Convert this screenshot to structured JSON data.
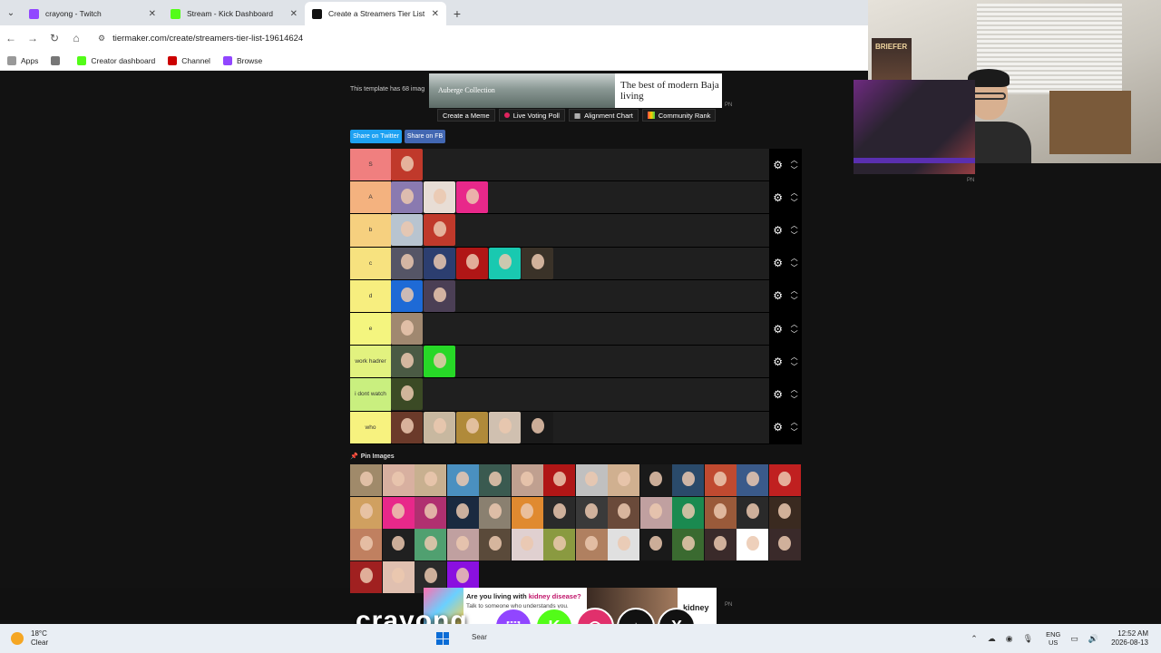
{
  "browser": {
    "tabs": [
      {
        "title": "crayong - Twitch",
        "color": "#9146ff",
        "active": false
      },
      {
        "title": "Stream - Kick Dashboard",
        "color": "#53fc18",
        "active": false
      },
      {
        "title": "Create a Streamers Tier List - Tie",
        "color": "#111111",
        "active": true
      }
    ],
    "new_tab": "+",
    "url": "tiermaker.com/create/streamers-tier-list-19614624",
    "bookmarks": [
      {
        "label": "Apps"
      },
      {
        "label": "Creator dashboard"
      },
      {
        "label": "Channel"
      },
      {
        "label": "Browse"
      }
    ]
  },
  "page": {
    "template_note": "This template has 68 imag",
    "ad_top": {
      "brand": "Auberge Collection",
      "copy": "The best of modern Baja living"
    },
    "menu": [
      "Create a Meme",
      "Live Voting Poll",
      "Alignment Chart",
      "Community Rank"
    ],
    "share": {
      "twitter": "Share on Twitter",
      "fb": "Share on FB"
    },
    "pin_label": "Pin Images",
    "pn_text": "PN"
  },
  "tiers": [
    {
      "label": "S",
      "color": "#f07f7f",
      "items": [
        "#c0392b"
      ]
    },
    {
      "label": "A",
      "color": "#f4b27f",
      "items": [
        "#8a7ab0",
        "#e8ddd5",
        "#e8288a"
      ]
    },
    {
      "label": "b",
      "color": "#f6d07f",
      "items": [
        "#b8c4d0",
        "#c0392b"
      ]
    },
    {
      "label": "c",
      "color": "#f7e27f",
      "items": [
        "#556",
        "#2c3e70",
        "#b01616",
        "#19c9b0",
        "#3a3228"
      ]
    },
    {
      "label": "d",
      "color": "#f7ee7f",
      "items": [
        "#1e6ad6",
        "#4b3f55"
      ]
    },
    {
      "label": "e",
      "color": "#f4f57f",
      "items": [
        "#a08870"
      ]
    },
    {
      "label": "work hadrer",
      "color": "#e2f27f",
      "items": [
        "#4a5a44",
        "#27d827"
      ]
    },
    {
      "label": "i dont watch",
      "color": "#c9ef7f",
      "items": [
        "#3b4a25"
      ]
    },
    {
      "label": "who",
      "color": "#f7f27f",
      "items": [
        "#6b3a2a",
        "#c8b8a0",
        "#b08a3a",
        "#d0c0b0",
        "#1a1a1a"
      ]
    }
  ],
  "pool": [
    "#a08a6a",
    "#d8b0a0",
    "#c8b090",
    "#4a90c0",
    "#3a5a50",
    "#c0a090",
    "#b01616",
    "#c0c0c0",
    "#d0b090",
    "#1a1a1a",
    "#2a4a6a",
    "#c04a30",
    "#3a5a8a",
    "#c02020",
    "#d0a060",
    "#e8288a",
    "#b03070",
    "#1a2a40",
    "#8a8070",
    "#e08a30",
    "#2a2a2a",
    "#3a3a3a",
    "#6a4a3a",
    "#c0a0a0",
    "#1a8a50",
    "#9a5a3a",
    "#2a2a2a",
    "#3a2a20",
    "#c08060",
    "#202020",
    "#50a070",
    "#c0a0a0",
    "#5a4a3a",
    "#e0d0d0",
    "#8a9a40",
    "#b08060",
    "#e0e0e0",
    "#1a1a1a",
    "#3a6a30",
    "#3a2a2a",
    "#ffffff",
    "#3a2a2a",
    "#a02020",
    "#e0c0b0",
    "#2a2a2a",
    "#8a10e0"
  ],
  "overlay": {
    "stream_name": "crayong",
    "poster_text": "BRIEFER"
  },
  "ad_bottom": {
    "headline_pre": "Are you living with ",
    "headline_key": "kidney disease?",
    "sub": "Talk to someone who understands you.",
    "logo": "kidney"
  },
  "socials": [
    {
      "icon": "twitch-icon",
      "glyph": "⬚",
      "color": "#9146ff"
    },
    {
      "icon": "kick-icon",
      "glyph": "K",
      "color": "#53fc18"
    },
    {
      "icon": "instagram-icon",
      "glyph": "◎",
      "color": "#e1306c"
    },
    {
      "icon": "tiktok-icon",
      "glyph": "♪",
      "color": "#111111"
    },
    {
      "icon": "x-icon",
      "glyph": "X",
      "color": "#111111"
    }
  ],
  "taskbar": {
    "temp": "18°C",
    "condition": "Clear",
    "search": "Sear",
    "lang1": "ENG",
    "lang2": "US",
    "time": "12:52 AM",
    "date": "2026-08-13"
  }
}
